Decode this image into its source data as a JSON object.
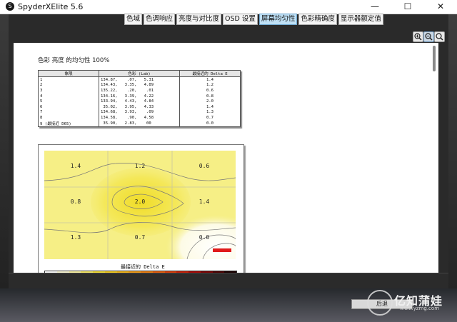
{
  "window": {
    "title": "SpyderXElite 5.6",
    "app_icon": "S",
    "min_icon": "minimize-icon",
    "max_icon": "maximize-icon",
    "close_icon": "close-icon",
    "min_glyph": "—",
    "max_glyph": "☐",
    "close_glyph": "✕"
  },
  "tabs": [
    {
      "label": "色域",
      "active": false
    },
    {
      "label": "色调响应",
      "active": false
    },
    {
      "label": "亮度与对比度",
      "active": false
    },
    {
      "label": "OSD 设置",
      "active": false
    },
    {
      "label": "屏幕均匀性",
      "active": true
    },
    {
      "label": "色彩精确度",
      "active": false
    },
    {
      "label": "显示器额定值",
      "active": false
    }
  ],
  "report": {
    "title": "色彩 亮度 的均匀性 100%",
    "table": {
      "headers": [
        "象限",
        "色彩 (Lab)",
        "最接近的 Delta E"
      ],
      "rows": [
        {
          "q": "1",
          "lab": "134.87,    .07,   5.31",
          "de": "1.4"
        },
        {
          "q": "2",
          "lab": "134.43,   3.35,   4.89",
          "de": "1.2"
        },
        {
          "q": "3",
          "lab": "135.22,    .20,    .01",
          "de": "0.6"
        },
        {
          "q": "4",
          "lab": "134.16,   3.39,   4.22",
          "de": "0.8"
        },
        {
          "q": "5",
          "lab": "133.94,   4.43,   4.84",
          "de": "2.0"
        },
        {
          "q": "6",
          "lab": " 35.02,   3.95,   4.33",
          "de": "1.4"
        },
        {
          "q": "7",
          "lab": "134.68,   3.93,    .09",
          "de": "1.3"
        },
        {
          "q": "8",
          "lab": "134.58,    .90,   4.58",
          "de": "0.7"
        },
        {
          "q": "9 (最接近 D65)",
          "lab": " 35.90,   2.83,    00",
          "de": "0.0"
        }
      ]
    },
    "heatmap": {
      "labels": [
        "1.4",
        "1.2",
        "0.6",
        "0.8",
        "2.0",
        "1.4",
        "1.3",
        "0.7",
        "0.0"
      ],
      "scale_title": "最接近的 Delta E",
      "scale_colors": [
        "#ffffff",
        "#fefbd8",
        "#fdf6a8",
        "#fbee6a",
        "#f9e23a",
        "#f7cf24",
        "#f5b81c",
        "#f39e18",
        "#ef8012",
        "#e8600e",
        "#dc400b",
        "#c92208",
        "#a80a06",
        "#7a0404",
        "#4a0202",
        "#1a0000"
      ]
    }
  },
  "footer": {
    "button_1": "后退",
    "watermark_text": "亿知蒲娃",
    "watermark_url": "www.yzmg.com"
  }
}
